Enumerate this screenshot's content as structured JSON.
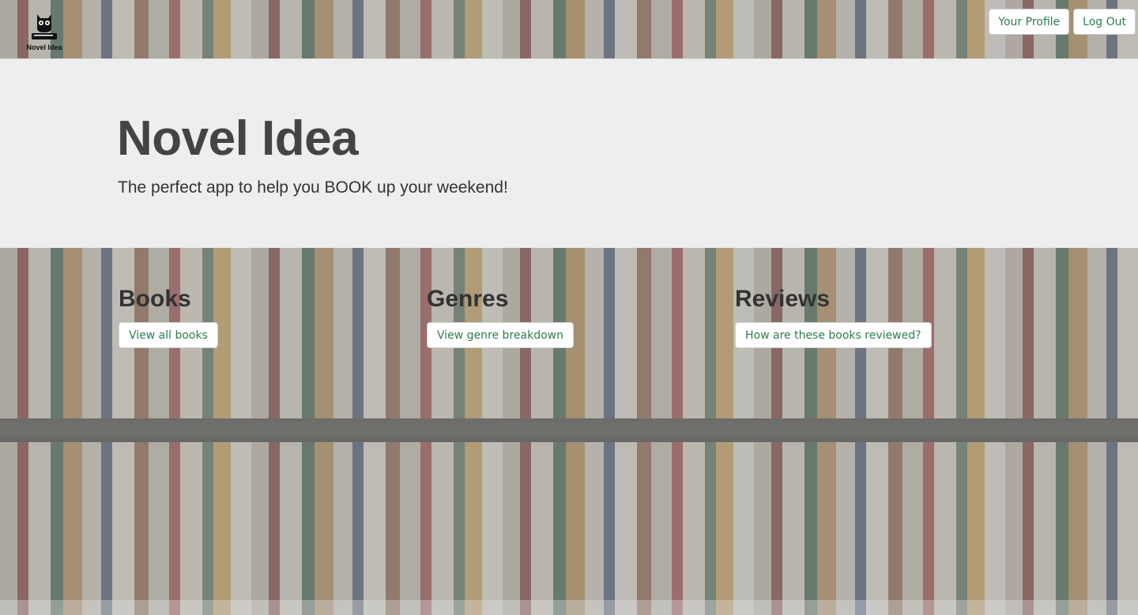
{
  "navbar": {
    "brand_label": "Novel Idea",
    "brand_icon": "owl-on-book-icon",
    "profile_label": "Your Profile",
    "logout_label": "Log Out"
  },
  "jumbotron": {
    "title": "Novel Idea",
    "subtitle": "The perfect app to help you BOOK up your weekend!"
  },
  "features": {
    "books": {
      "heading": "Books",
      "button": "View all books"
    },
    "genres": {
      "heading": "Genres",
      "button": "View genre breakdown"
    },
    "reviews": {
      "heading": "Reviews",
      "button": "How are these books reviewed?"
    }
  },
  "colors": {
    "button_text": "#2e7d4f",
    "jumbotron_bg": "#eeeeee",
    "heading": "#333333"
  }
}
